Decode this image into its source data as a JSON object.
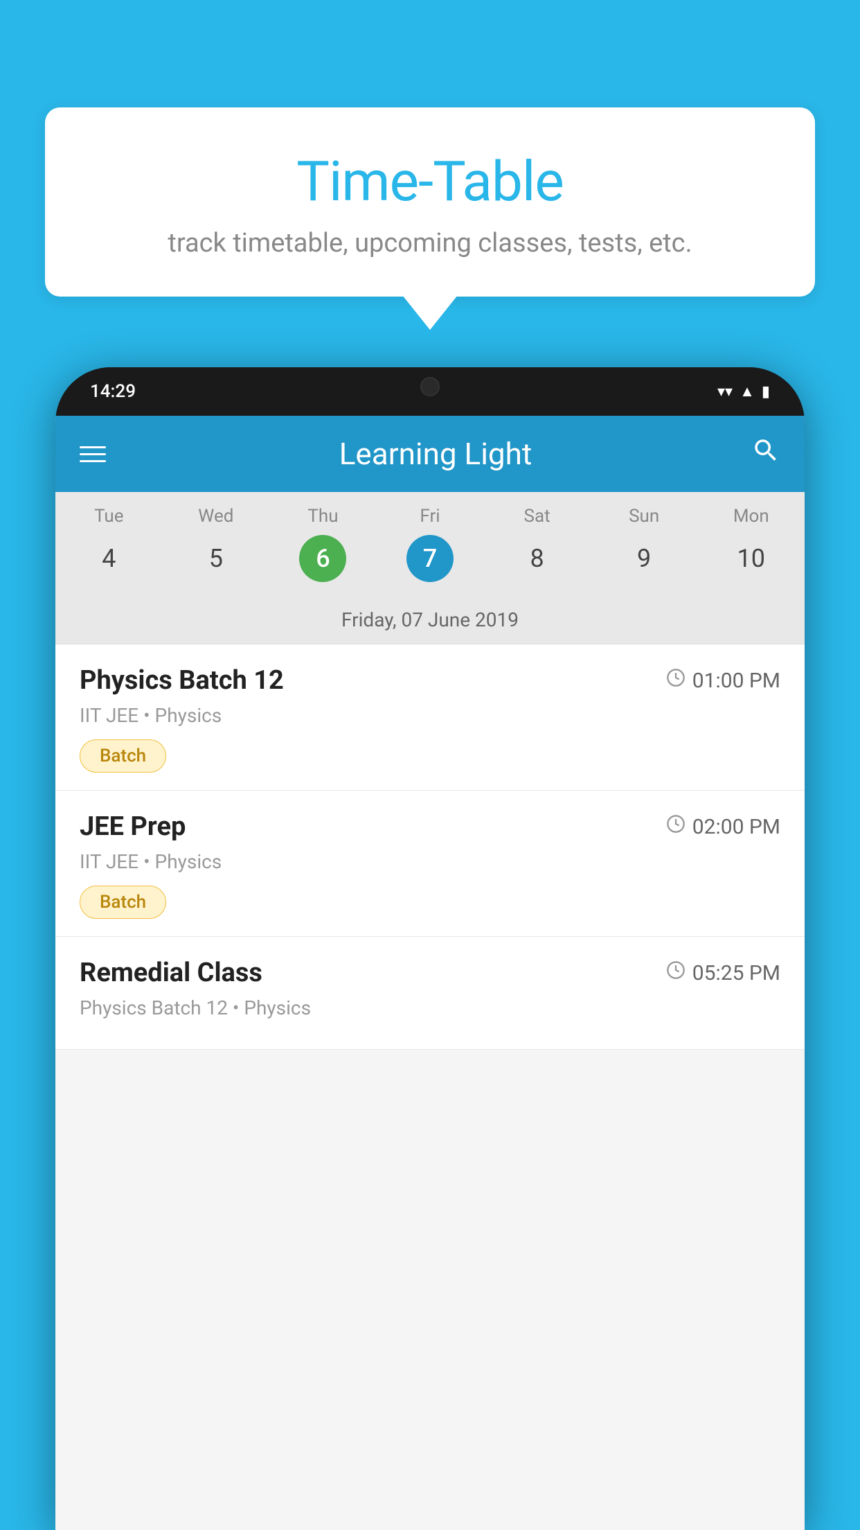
{
  "background_color": "#29B6E8",
  "speech_bubble": {
    "title": "Time-Table",
    "subtitle": "track timetable, upcoming classes, tests, etc."
  },
  "phone": {
    "status_bar": {
      "time": "14:29",
      "icons": [
        "wifi",
        "signal",
        "battery"
      ]
    },
    "app_bar": {
      "title": "Learning Light",
      "menu_icon": "menu-icon",
      "search_icon": "search-icon"
    },
    "calendar": {
      "days": [
        {
          "name": "Tue",
          "number": "4",
          "state": "normal"
        },
        {
          "name": "Wed",
          "number": "5",
          "state": "normal"
        },
        {
          "name": "Thu",
          "number": "6",
          "state": "today"
        },
        {
          "name": "Fri",
          "number": "7",
          "state": "selected"
        },
        {
          "name": "Sat",
          "number": "8",
          "state": "normal"
        },
        {
          "name": "Sun",
          "number": "9",
          "state": "normal"
        },
        {
          "name": "Mon",
          "number": "10",
          "state": "normal"
        }
      ],
      "selected_date_label": "Friday, 07 June 2019"
    },
    "schedule_items": [
      {
        "title": "Physics Batch 12",
        "time": "01:00 PM",
        "subtitle": "IIT JEE • Physics",
        "badge": "Batch"
      },
      {
        "title": "JEE Prep",
        "time": "02:00 PM",
        "subtitle": "IIT JEE • Physics",
        "badge": "Batch"
      },
      {
        "title": "Remedial Class",
        "time": "05:25 PM",
        "subtitle": "Physics Batch 12 • Physics",
        "badge": null
      }
    ]
  }
}
